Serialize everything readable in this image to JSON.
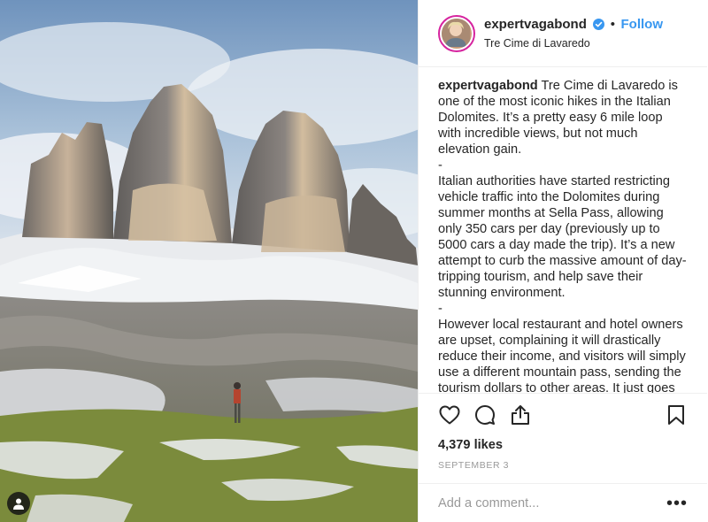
{
  "post": {
    "username": "expertvagabond",
    "follow_label": "Follow",
    "separator": "•",
    "location": "Tre Cime di Lavaredo",
    "caption": {
      "username": "expertvagabond",
      "paragraphs": [
        "Tre Cime di Lavaredo is one of the most iconic hikes in the Italian Dolomites. It’s a pretty easy 6 mile loop with incredible views, but not much elevation gain.",
        "-",
        "Italian authorities have started restricting vehicle traffic into the Dolomites during summer months at Sella Pass, allowing only 350 cars per day (previously up to 5000 cars a day made the trip). It’s a new attempt to curb the massive amount of day-tripping tourism, and help save their stunning environment.",
        "-",
        "However local restaurant and hotel owners are upset, complaining it will drastically reduce their income, and visitors will simply use a different mountain pass, sending the tourism dollars to other areas. It just goes to show there are many sides to each story."
      ]
    },
    "likes": "4,379 likes",
    "date": "SEPTEMBER 3",
    "comment_placeholder": "Add a comment...",
    "more_label": "•••",
    "icons": {
      "verified": "verified-badge-icon",
      "like": "heart-icon",
      "comment": "comment-bubble-icon",
      "share": "share-icon",
      "save": "bookmark-icon",
      "tag": "user-tag-icon"
    },
    "colors": {
      "accent": "#3897f0",
      "text": "#262626",
      "muted": "#999999",
      "border": "#efefef"
    }
  }
}
